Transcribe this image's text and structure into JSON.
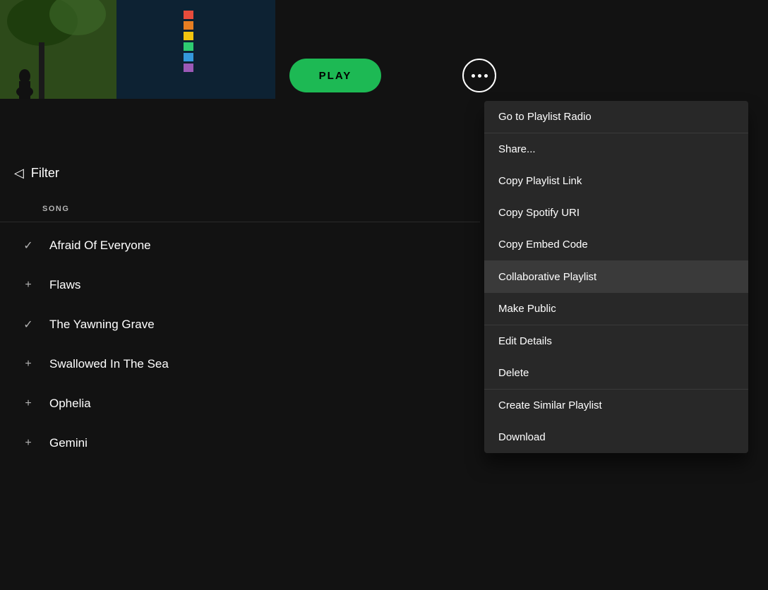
{
  "background": {
    "left_album_color": "#2d4a1a",
    "right_album_color": "#1a3a4a"
  },
  "header": {
    "play_button_label": "PLAY"
  },
  "filter": {
    "label": "Filter"
  },
  "song_list": {
    "header": "SONG",
    "songs": [
      {
        "name": "Afraid Of Everyone",
        "icon": "checkmark",
        "icon_char": "✓"
      },
      {
        "name": "Flaws",
        "icon": "plus",
        "icon_char": "+"
      },
      {
        "name": "The Yawning Grave",
        "icon": "checkmark",
        "icon_char": "✓"
      },
      {
        "name": "Swallowed In The Sea",
        "icon": "plus",
        "icon_char": "+"
      },
      {
        "name": "Ophelia",
        "icon": "plus",
        "icon_char": "+"
      },
      {
        "name": "Gemini",
        "icon": "plus",
        "icon_char": "+"
      }
    ]
  },
  "context_menu": {
    "sections": [
      {
        "items": [
          {
            "label": "Go to Playlist Radio"
          }
        ]
      },
      {
        "items": [
          {
            "label": "Share..."
          },
          {
            "label": "Copy Playlist Link"
          },
          {
            "label": "Copy Spotify URI"
          },
          {
            "label": "Copy Embed Code"
          }
        ]
      },
      {
        "items": [
          {
            "label": "Collaborative Playlist",
            "highlighted": true
          },
          {
            "label": "Make Public"
          }
        ]
      },
      {
        "items": [
          {
            "label": "Edit Details"
          },
          {
            "label": "Delete"
          }
        ]
      },
      {
        "items": [
          {
            "label": "Create Similar Playlist"
          },
          {
            "label": "Download"
          }
        ]
      }
    ]
  },
  "color_bars": [
    "#e74c3c",
    "#e67e22",
    "#f1c40f",
    "#2ecc71",
    "#3498db",
    "#9b59b6"
  ]
}
